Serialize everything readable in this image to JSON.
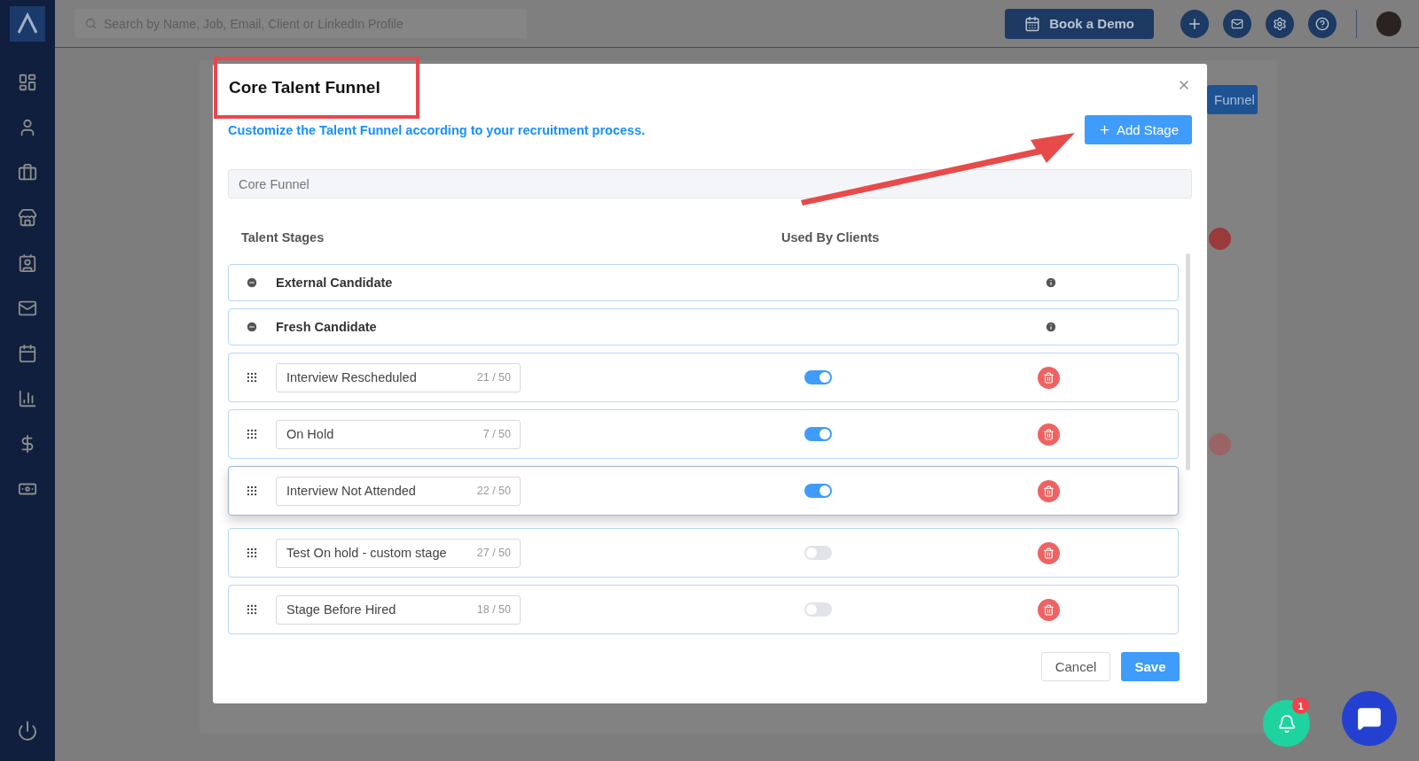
{
  "topbar": {
    "search_placeholder": "Search by Name, Job, Email, Client or LinkedIn Profile",
    "demo_button": "Book a Demo"
  },
  "sidebar": {
    "items": [
      {
        "kind": "dashboard"
      },
      {
        "kind": "people"
      },
      {
        "kind": "jobs"
      },
      {
        "kind": "clients"
      },
      {
        "kind": "contacts"
      },
      {
        "kind": "mail"
      },
      {
        "kind": "calendar"
      },
      {
        "kind": "reports"
      },
      {
        "kind": "billing"
      },
      {
        "kind": "payments"
      }
    ]
  },
  "background": {
    "button": "Funnel"
  },
  "modal": {
    "title": "Core Talent Funnel",
    "subtitle": "Customize the Talent Funnel according to your recruitment process.",
    "add_button": "Add Stage",
    "funnel_name": "Core Funnel",
    "columns": [
      "Talent Stages",
      "Used By Clients"
    ],
    "stages": [
      {
        "kind": "fixed",
        "name": "External Candidate"
      },
      {
        "kind": "fixed",
        "name": "Fresh Candidate"
      },
      {
        "kind": "custom",
        "name": "Interview Rescheduled",
        "count": "21 / 50",
        "on": true,
        "dragging": false
      },
      {
        "kind": "custom",
        "name": "On Hold",
        "count": "7 / 50",
        "on": true,
        "dragging": false
      },
      {
        "kind": "custom",
        "name": "Interview Not Attended",
        "count": "22 / 50",
        "on": true,
        "dragging": true
      },
      {
        "kind": "custom",
        "name": "Test On hold - custom stage",
        "count": "27 / 50",
        "on": false,
        "dragging": false
      },
      {
        "kind": "custom",
        "name": "Stage Before Hired",
        "count": "18 / 50",
        "on": false,
        "dragging": false
      }
    ],
    "cancel_button": "Cancel",
    "save_button": "Save"
  },
  "notifications": {
    "badge": "1"
  }
}
